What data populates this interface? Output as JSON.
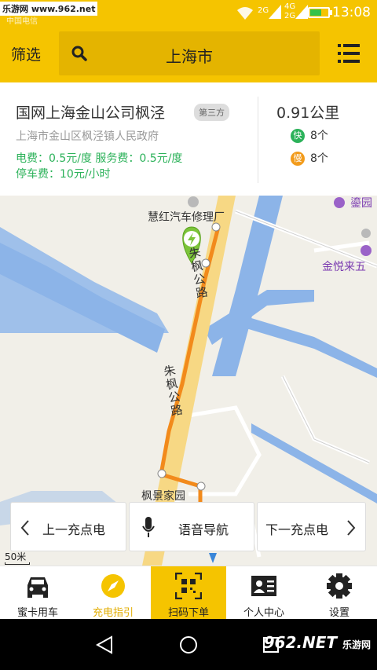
{
  "statusbar": {
    "watermark": "乐游网 www.962.net",
    "carrier": "中国电信",
    "net_1": "2G",
    "net_2": "4G",
    "net_3": "2G",
    "time": "13:08",
    "battery_level": 0.6
  },
  "topbar": {
    "filter_label": "筛选",
    "city": "上海市"
  },
  "station": {
    "name": "国网上海金山公司枫泾",
    "badge": "第三方",
    "address": "上海市金山区枫泾镇人民政府",
    "fee_line_1": "电费：0.5元/度   服务费：0.5元/度",
    "fee_line_2": "停车费：10元/小时",
    "distance": "0.91公里",
    "fast_icon": "快",
    "fast_count": "8个",
    "slow_icon": "慢",
    "slow_count": "8个"
  },
  "map": {
    "poi_repair": "慧红汽车修理厂",
    "poi_garden": "鎏园",
    "poi_jinyue": "金悦来五",
    "poi_fengjing": "枫景家园",
    "road_top": "朱枫公路",
    "road_mid": "朱枫公路",
    "scale": "50米"
  },
  "nav_overlay": {
    "prev": "上一充点电",
    "voice": "语音导航",
    "next": "下一充点电"
  },
  "tabs": [
    {
      "label": "蜜卡用车",
      "icon": "car-icon"
    },
    {
      "label": "充电指引",
      "icon": "compass-icon"
    },
    {
      "label": "扫码下单",
      "icon": "qr-scan-icon"
    },
    {
      "label": "个人中心",
      "icon": "id-card-icon"
    },
    {
      "label": "设置",
      "icon": "gear-icon"
    }
  ],
  "sysnav": {
    "watermark": "962.NET",
    "watermark_sub": "乐游网"
  },
  "colors": {
    "brand_yellow": "#f5c400",
    "route_orange": "#f28a1b",
    "fee_green": "#2cb25a",
    "water_blue": "#8cb4e8"
  }
}
